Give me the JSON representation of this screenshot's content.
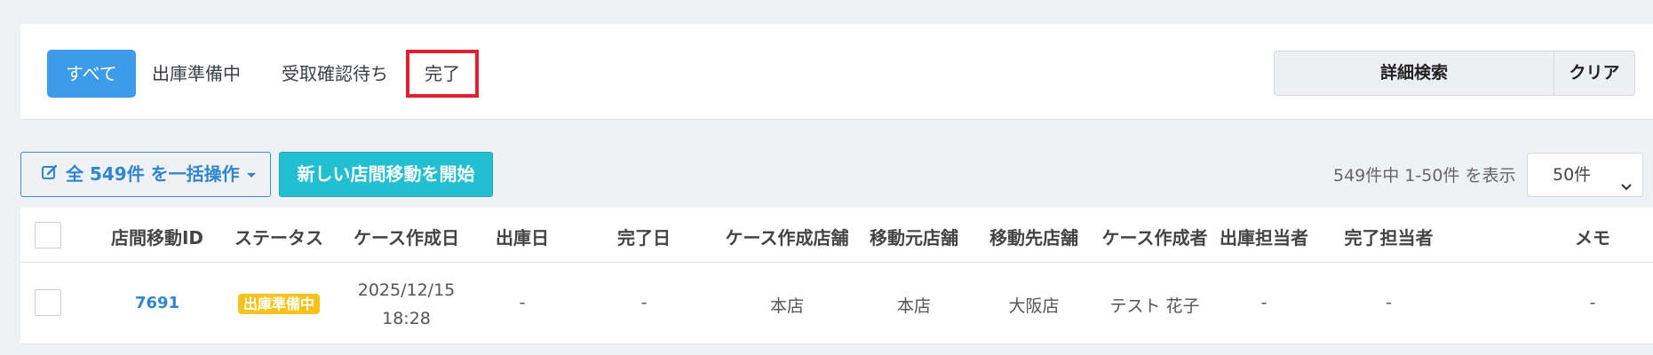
{
  "tabs": [
    {
      "label": "すべて"
    },
    {
      "label": "出庫準備中"
    },
    {
      "label": "受取確認待ち"
    },
    {
      "label": "完了"
    }
  ],
  "search": {
    "detail_label": "詳細検索",
    "clear_label": "クリア"
  },
  "toolbar": {
    "bulk_label": "全 549件 を一括操作",
    "start_label": "新しい店間移動を開始",
    "count_text": "549件中 1-50件 を表示",
    "per_page": "50件"
  },
  "table": {
    "headers": [
      "店間移動ID",
      "ステータス",
      "ケース作成日",
      "出庫日",
      "完了日",
      "ケース作成店舗",
      "移動元店舗",
      "移動先店舗",
      "ケース作成者",
      "出庫担当者",
      "完了担当者",
      "メモ"
    ],
    "rows": [
      {
        "id": "7691",
        "status": "出庫準備中",
        "created_date": "2025/12/15",
        "created_time": "18:28",
        "shipped": "-",
        "completed": "-",
        "created_store": "本店",
        "from_store": "本店",
        "to_store": "大阪店",
        "creator": "テスト 花子",
        "shipper": "-",
        "completer": "-",
        "memo": "-"
      }
    ]
  },
  "colors": {
    "accent": "#3d9be9",
    "teal": "#22bfd2",
    "badge": "#f8c21b",
    "highlight": "#e0202e"
  }
}
